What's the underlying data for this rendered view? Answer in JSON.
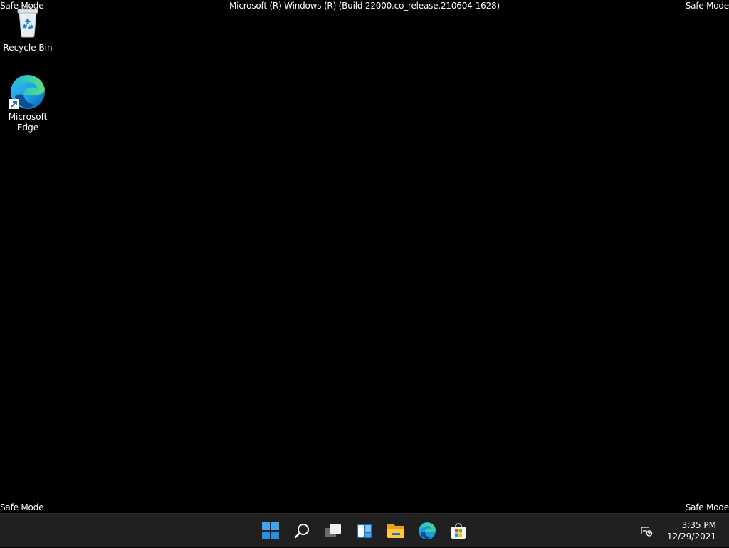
{
  "watermarks": {
    "top_left": "Safe Mode",
    "top_right": "Safe Mode",
    "bottom_left": "Safe Mode",
    "bottom_right": "Safe Mode",
    "build": "Microsoft (R) Windows (R) (Build 22000.co_release.210604-1628)"
  },
  "desktop_icons": [
    {
      "label": "Recycle Bin",
      "icon": "recycle-bin-icon"
    },
    {
      "label": "Microsoft\nEdge",
      "icon": "edge-icon"
    }
  ],
  "taskbar": {
    "items": [
      {
        "name": "start",
        "icon": "windows-start-icon"
      },
      {
        "name": "search",
        "icon": "search-icon"
      },
      {
        "name": "task-view",
        "icon": "task-view-icon"
      },
      {
        "name": "widgets",
        "icon": "widgets-icon"
      },
      {
        "name": "file-explorer",
        "icon": "folder-icon"
      },
      {
        "name": "edge",
        "icon": "edge-icon"
      },
      {
        "name": "store",
        "icon": "store-icon"
      }
    ],
    "tray": {
      "network_icon": "network-disconnected-icon",
      "time": "3:35 PM",
      "date": "12/29/2021"
    }
  },
  "colors": {
    "background": "#000000",
    "taskbar": "#202020",
    "accent": "#0078d4"
  }
}
